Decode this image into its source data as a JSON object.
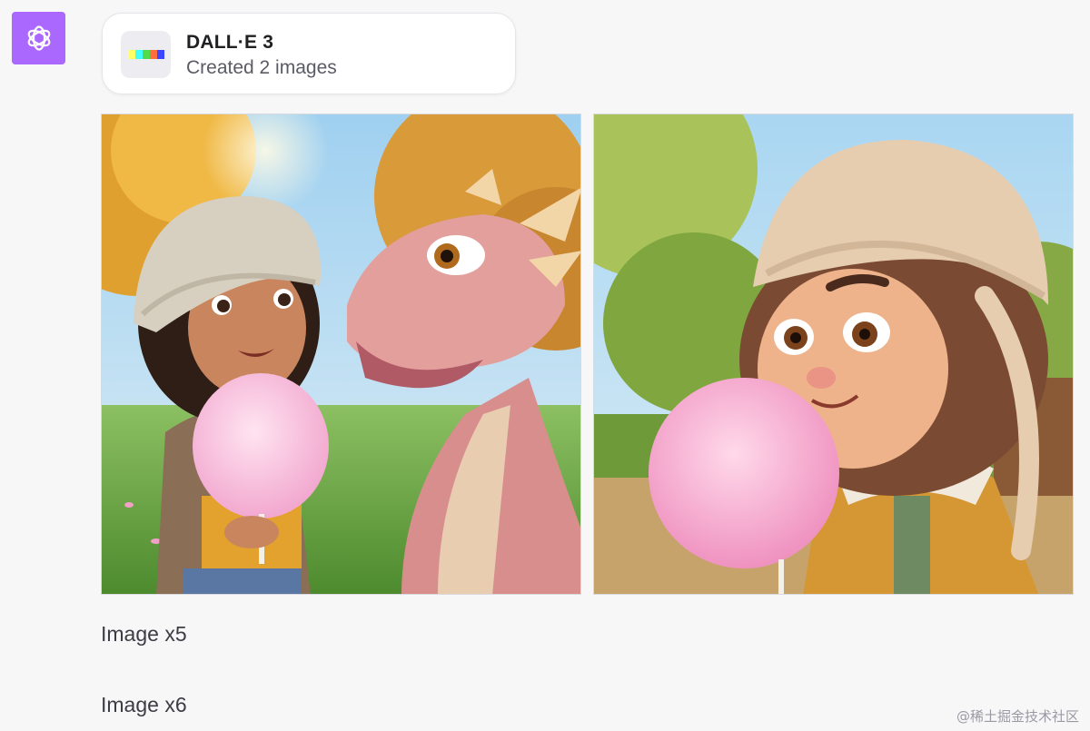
{
  "message": {
    "avatar_icon": "openai-logo-icon",
    "avatar_color": "#ab68ff"
  },
  "tool_card": {
    "icon": "dalle-palette-icon",
    "title": "DALL·E 3",
    "subtitle": "Created 2 images"
  },
  "images": [
    {
      "subject": "girl-and-dragon-with-cotton-candy"
    },
    {
      "subject": "girl-with-cotton-candy-closeup"
    }
  ],
  "captions": [
    "Image x5",
    "Image x6"
  ],
  "watermark": "@稀土掘金技术社区"
}
